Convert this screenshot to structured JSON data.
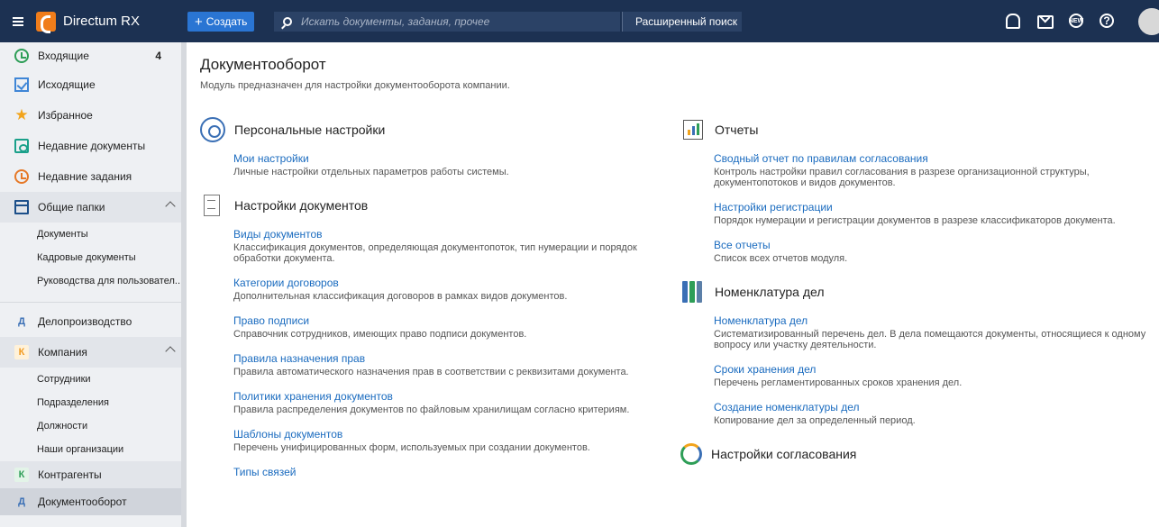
{
  "app": {
    "name": "Directum RX",
    "create_label": "Создать",
    "search_placeholder": "Искать документы, задания, прочее",
    "advanced_search_label": "Расширенный поиск",
    "brand_color": "#1c3152",
    "accent_color": "#2a75d3"
  },
  "sidebar": {
    "items": [
      {
        "label": "Входящие",
        "count": "4",
        "icon": "inbox-clock-icon"
      },
      {
        "label": "Исходящие",
        "icon": "outbox-check-icon"
      },
      {
        "label": "Избранное",
        "icon": "star-icon"
      },
      {
        "label": "Недавние документы",
        "icon": "recent-documents-icon"
      },
      {
        "label": "Недавние задания",
        "icon": "recent-tasks-icon"
      },
      {
        "label": "Общие папки",
        "icon": "folder-icon"
      }
    ],
    "shared_folders": [
      "Документы",
      "Кадровые документы",
      "Руководства для пользовател..."
    ],
    "modules": [
      {
        "letter": "Д",
        "label": "Делопроизводство"
      },
      {
        "letter": "К",
        "label": "Компания"
      }
    ],
    "company_items": [
      "Сотрудники",
      "Подразделения",
      "Должности",
      "Наши организации"
    ],
    "bottom_modules": [
      {
        "letter": "К",
        "label": "Контрагенты"
      },
      {
        "letter": "Д",
        "label": "Документооборот"
      }
    ]
  },
  "main": {
    "title": "Документооборот",
    "description": "Модуль предназначен для настройки документооборота компании.",
    "left_sections": [
      {
        "title": "Персональные настройки",
        "icon": "gear-person-icon",
        "entries": [
          {
            "link": "Мои настройки",
            "desc": "Личные настройки отдельных параметров работы системы."
          }
        ]
      },
      {
        "title": "Настройки документов",
        "icon": "documents-icon",
        "entries": [
          {
            "link": "Виды документов",
            "desc": "Классификация документов, определяющая документопоток, тип нумерации и порядок обработки документа."
          },
          {
            "link": "Категории договоров",
            "desc": "Дополнительная классификация договоров в рамках видов документов."
          },
          {
            "link": "Право подписи",
            "desc": "Справочник сотрудников, имеющих право подписи документов."
          },
          {
            "link": "Правила назначения прав",
            "desc": "Правила автоматического назначения прав в соответствии с реквизитами документа."
          },
          {
            "link": "Политики хранения документов",
            "desc": "Правила распределения документов по файловым хранилищам согласно критериям."
          },
          {
            "link": "Шаблоны документов",
            "desc": "Перечень унифицированных форм, используемых при создании документов."
          },
          {
            "link": "Типы связей",
            "desc": ""
          }
        ]
      }
    ],
    "right_sections": [
      {
        "title": "Отчеты",
        "icon": "reports-chart-icon",
        "entries": [
          {
            "link": "Сводный отчет по правилам согласования",
            "desc": "Контроль настройки правил согласования в разрезе организационной структуры, документопотоков и видов документов."
          },
          {
            "link": "Настройки регистрации",
            "desc": "Порядок нумерации и регистрации документов в разрезе классификаторов документа."
          },
          {
            "link": "Все отчеты",
            "desc": "Список всех отчетов модуля."
          }
        ]
      },
      {
        "title": "Номенклатура дел",
        "icon": "binders-icon",
        "entries": [
          {
            "link": "Номенклатура дел",
            "desc": "Систематизированный перечень дел. В дела помещаются документы, относящиеся к одному вопросу или участку деятельности."
          },
          {
            "link": "Сроки хранения дел",
            "desc": "Перечень регламентированных сроков хранения дел."
          },
          {
            "link": "Создание номенклатуры дел",
            "desc": "Копирование дел за определенный период."
          }
        ]
      },
      {
        "title": "Настройки согласования",
        "icon": "approval-cycle-icon",
        "entries": []
      }
    ]
  }
}
